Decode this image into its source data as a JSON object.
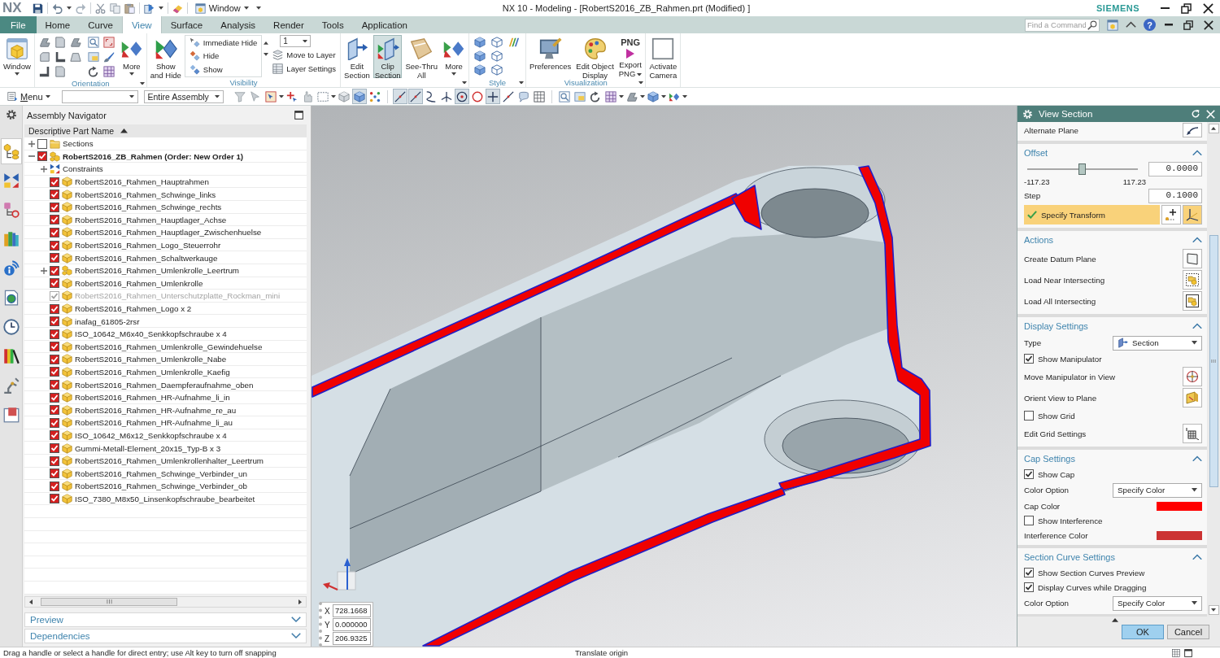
{
  "window": {
    "logo": "NX",
    "quick_menu": "Window",
    "title": "NX 10 - Modeling - [RobertS2016_ZB_Rahmen.prt (Modified) ]",
    "brand": "SIEMENS"
  },
  "menu_tabs": [
    {
      "label": "File",
      "kind": "file",
      "selected": false
    },
    {
      "label": "Home",
      "kind": "tab",
      "selected": false
    },
    {
      "label": "Curve",
      "kind": "tab",
      "selected": false
    },
    {
      "label": "View",
      "kind": "tab",
      "selected": true
    },
    {
      "label": "Surface",
      "kind": "tab",
      "selected": false
    },
    {
      "label": "Analysis",
      "kind": "tab",
      "selected": false
    },
    {
      "label": "Render",
      "kind": "tab",
      "selected": false
    },
    {
      "label": "Tools",
      "kind": "tab",
      "selected": false
    },
    {
      "label": "Application",
      "kind": "tab",
      "selected": false
    }
  ],
  "command_search": {
    "placeholder": "Find a Command"
  },
  "help_button": "?",
  "ribbon": {
    "groups": [
      {
        "kind": "window",
        "buttons": [
          {
            "lines": [
              "Window"
            ],
            "dropdown": true
          }
        ]
      },
      {
        "kind": "orientation",
        "label": "Orientation",
        "buttons": [
          {
            "lines": [
              "More"
            ],
            "dropdown": true
          }
        ]
      },
      {
        "kind": "visibility",
        "label": "Visibility",
        "buttons": [
          {
            "lines": [
              "Show",
              "and Hide"
            ],
            "dropdown": false
          }
        ],
        "actions": [
          "Immediate Hide",
          "Hide",
          "Show"
        ],
        "layer": "1",
        "layer_actions": [
          "Move to Layer",
          "Layer Settings"
        ]
      },
      {
        "kind": "section",
        "buttons": [
          {
            "lines": [
              "Edit",
              "Section"
            ],
            "dropdown": false,
            "selected": false
          },
          {
            "lines": [
              "Clip",
              "Section"
            ],
            "dropdown": false,
            "selected": true
          },
          {
            "lines": [
              "See-Thru",
              "All"
            ],
            "dropdown": false,
            "selected": false
          },
          {
            "lines": [
              "More"
            ],
            "dropdown": true,
            "selected": false
          }
        ]
      },
      {
        "kind": "style",
        "label": "Style"
      },
      {
        "kind": "visualization",
        "label": "Visualization",
        "buttons": [
          {
            "lines": [
              "Preferences"
            ],
            "dropdown": false
          },
          {
            "lines": [
              "Edit Object",
              "Display"
            ],
            "dropdown": false
          },
          {
            "lines": [
              "Export",
              "PNG"
            ],
            "dropdown": true,
            "badge": "PNG"
          }
        ]
      },
      {
        "kind": "camera",
        "buttons": [
          {
            "lines": [
              "Activate",
              "Camera"
            ],
            "dropdown": false
          }
        ]
      }
    ]
  },
  "toolbar": {
    "menu": "Menu",
    "scope": "Entire Assembly",
    "tools": [
      {
        "selected": false
      },
      {
        "selected": false
      },
      {
        "selected": false
      },
      {
        "selected": false
      },
      {
        "selected": false
      },
      {
        "selected": false
      },
      {
        "selected": false
      },
      {
        "selected": true
      },
      {
        "selected": false
      },
      {
        "selected": true
      },
      {
        "selected": true
      },
      {
        "selected": false
      },
      {
        "selected": false
      },
      {
        "selected": true
      },
      {
        "selected": false
      },
      {
        "selected": true
      },
      {
        "selected": false
      },
      {
        "selected": false
      },
      {
        "selected": false
      },
      {
        "selected": false
      },
      {
        "selected": false
      },
      {
        "selected": false
      },
      {
        "selected": false
      },
      {
        "selected": false
      },
      {
        "selected": false
      },
      {
        "selected": false
      }
    ]
  },
  "resource_tabs": [
    {
      "selected": true
    },
    {
      "selected": false
    },
    {
      "selected": false
    },
    {
      "selected": false
    },
    {
      "selected": false
    },
    {
      "selected": false
    },
    {
      "selected": false
    },
    {
      "selected": false
    },
    {
      "selected": false
    },
    {
      "selected": false
    }
  ],
  "navigator": {
    "title": "Assembly Navigator",
    "column": "Descriptive Part Name",
    "tree": [
      {
        "label": "Sections",
        "kind": "folder",
        "checked": false,
        "expanded": false,
        "disabled": false
      },
      {
        "label": "RobertS2016_ZB_Rahmen (Order: New Order 1)",
        "kind": "root",
        "checked": true,
        "expanded": true,
        "disabled": false,
        "children": [
          {
            "label": "Constraints",
            "kind": "constraints",
            "expanded": false,
            "disabled": false
          },
          {
            "label": "RobertS2016_Rahmen_Hauptrahmen",
            "kind": "part",
            "checked": true,
            "disabled": false
          },
          {
            "label": "RobertS2016_Rahmen_Schwinge_links",
            "kind": "part",
            "checked": true,
            "disabled": false
          },
          {
            "label": "RobertS2016_Rahmen_Schwinge_rechts",
            "kind": "part",
            "checked": true,
            "disabled": false
          },
          {
            "label": "RobertS2016_Rahmen_Hauptlager_Achse",
            "kind": "part",
            "checked": true,
            "disabled": false
          },
          {
            "label": "RobertS2016_Rahmen_Hauptlager_Zwischenhuelse",
            "kind": "part",
            "checked": true,
            "disabled": false
          },
          {
            "label": "RobertS2016_Rahmen_Logo_Steuerrohr",
            "kind": "part",
            "checked": true,
            "disabled": false
          },
          {
            "label": "RobertS2016_Rahmen_Schaltwerkauge",
            "kind": "part",
            "checked": true,
            "disabled": false
          },
          {
            "label": "RobertS2016_Rahmen_Umlenkrolle_Leertrum",
            "kind": "subassembly",
            "checked": true,
            "expanded": false,
            "disabled": false
          },
          {
            "label": "RobertS2016_Rahmen_Umlenkrolle",
            "kind": "part",
            "checked": true,
            "disabled": false
          },
          {
            "label": "RobertS2016_Rahmen_Unterschutzplatte_Rockman_mini",
            "kind": "part",
            "checked": true,
            "disabled": true
          },
          {
            "label": "RobertS2016_Rahmen_Logo x 2",
            "kind": "part",
            "checked": true,
            "disabled": false
          },
          {
            "label": "inafag_61805-2rsr",
            "kind": "part",
            "checked": true,
            "disabled": false
          },
          {
            "label": "ISO_10642_M6x40_Senkkopfschraube x 4",
            "kind": "part",
            "checked": true,
            "disabled": false
          },
          {
            "label": "RobertS2016_Rahmen_Umlenkrolle_Gewindehuelse",
            "kind": "part",
            "checked": true,
            "disabled": false
          },
          {
            "label": "RobertS2016_Rahmen_Umlenkrolle_Nabe",
            "kind": "part",
            "checked": true,
            "disabled": false
          },
          {
            "label": "RobertS2016_Rahmen_Umlenkrolle_Kaefig",
            "kind": "part",
            "checked": true,
            "disabled": false
          },
          {
            "label": "RobertS2016_Rahmen_Daempferaufnahme_oben",
            "kind": "part",
            "checked": true,
            "disabled": false
          },
          {
            "label": "RobertS2016_Rahmen_HR-Aufnahme_li_in",
            "kind": "part",
            "checked": true,
            "disabled": false
          },
          {
            "label": "RobertS2016_Rahmen_HR-Aufnahme_re_au",
            "kind": "part",
            "checked": true,
            "disabled": false
          },
          {
            "label": "RobertS2016_Rahmen_HR-Aufnahme_li_au",
            "kind": "part",
            "checked": true,
            "disabled": false
          },
          {
            "label": "ISO_10642_M6x12_Senkkopfschraube x 4",
            "kind": "part",
            "checked": true,
            "disabled": false
          },
          {
            "label": "Gummi-Metall-Element_20x15_Typ-B x 3",
            "kind": "part",
            "checked": true,
            "disabled": false
          },
          {
            "label": "RobertS2016_Rahmen_Umlenkrollenhalter_Leertrum",
            "kind": "part",
            "checked": true,
            "disabled": false
          },
          {
            "label": "RobertS2016_Rahmen_Schwinge_Verbinder_un",
            "kind": "part",
            "checked": true,
            "disabled": false
          },
          {
            "label": "RobertS2016_Rahmen_Schwinge_Verbinder_ob",
            "kind": "part",
            "checked": true,
            "disabled": false
          },
          {
            "label": "ISO_7380_M8x50_Linsenkopfschraube_bearbeitet",
            "kind": "part",
            "checked": true,
            "disabled": false
          }
        ]
      }
    ],
    "panels": [
      {
        "label": "Preview",
        "expanded": false
      },
      {
        "label": "Dependencies",
        "expanded": false
      }
    ]
  },
  "viewport": {
    "coordinate_entry": [
      {
        "axis": "X",
        "value": "728.1668"
      },
      {
        "axis": "Y",
        "value": "0.000000"
      },
      {
        "axis": "Z",
        "value": "206.9325"
      }
    ]
  },
  "dialog": {
    "title": "View Section",
    "sections": [
      {
        "kind": "tail",
        "rows": [
          {
            "kind": "button",
            "label": "Alternate Plane"
          }
        ]
      },
      {
        "kind": "group",
        "title": "Offset",
        "expanded": true,
        "rows": [
          {
            "kind": "slider",
            "level": 0.5,
            "min": "-117.23",
            "max": "117.23",
            "value": "0.0000"
          },
          {
            "kind": "field",
            "label": "Step",
            "value": "0.1000"
          },
          {
            "kind": "selection",
            "label": "Specify Transform",
            "selected": true,
            "done": true
          }
        ]
      },
      {
        "kind": "group",
        "title": "Actions",
        "expanded": true,
        "rows": [
          {
            "kind": "button",
            "label": "Create Datum Plane"
          },
          {
            "kind": "button",
            "label": "Load Near Intersecting"
          },
          {
            "kind": "button",
            "label": "Load All Intersecting"
          }
        ]
      },
      {
        "kind": "group",
        "title": "Display Settings",
        "expanded": true,
        "rows": [
          {
            "kind": "icon_dropdown",
            "label": "Type",
            "value": "Section"
          },
          {
            "kind": "checkbox",
            "label": "Show Manipulator",
            "checked": true
          },
          {
            "kind": "button",
            "label": "Move Manipulator in View"
          },
          {
            "kind": "button",
            "label": "Orient View to Plane"
          },
          {
            "kind": "checkbox",
            "label": "Show Grid",
            "checked": false
          },
          {
            "kind": "button",
            "label": "Edit Grid Settings"
          }
        ]
      },
      {
        "kind": "group",
        "title": "Cap Settings",
        "expanded": true,
        "rows": [
          {
            "kind": "checkbox",
            "label": "Show Cap",
            "checked": true
          },
          {
            "kind": "dropdown",
            "label": "Color Option",
            "value": "Specify Color"
          },
          {
            "kind": "color",
            "label": "Cap Color",
            "color": "#ff0000"
          },
          {
            "kind": "checkbox",
            "label": "Show Interference",
            "checked": false
          },
          {
            "kind": "color",
            "label": "Interference Color",
            "color": "#cc3333"
          }
        ]
      },
      {
        "kind": "group",
        "title": "Section Curve Settings",
        "expanded": true,
        "rows": [
          {
            "kind": "checkbox",
            "label": "Show Section Curves Preview",
            "checked": true
          },
          {
            "kind": "checkbox",
            "label": "Display Curves while Dragging",
            "checked": true
          },
          {
            "kind": "dropdown",
            "label": "Color Option",
            "value": "Specify Color"
          }
        ]
      }
    ],
    "buttons": [
      {
        "label": "OK",
        "kind": "default"
      },
      {
        "label": "Cancel",
        "kind": "normal"
      }
    ]
  },
  "status_bar": {
    "prompt": "Drag a handle or select a handle for direct entry; use Alt key to turn off snapping",
    "message": "Translate origin"
  }
}
